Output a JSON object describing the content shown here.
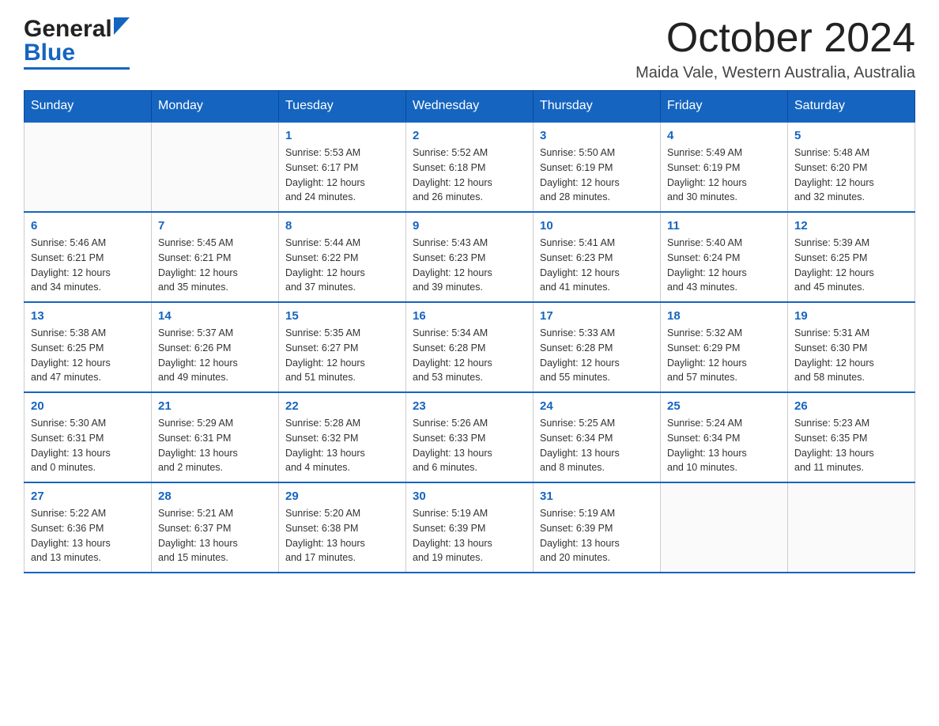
{
  "header": {
    "month_title": "October 2024",
    "location": "Maida Vale, Western Australia, Australia",
    "logo_general": "General",
    "logo_blue": "Blue"
  },
  "calendar": {
    "days_of_week": [
      "Sunday",
      "Monday",
      "Tuesday",
      "Wednesday",
      "Thursday",
      "Friday",
      "Saturday"
    ],
    "weeks": [
      [
        {
          "day": "",
          "details": ""
        },
        {
          "day": "",
          "details": ""
        },
        {
          "day": "1",
          "details": "Sunrise: 5:53 AM\nSunset: 6:17 PM\nDaylight: 12 hours\nand 24 minutes."
        },
        {
          "day": "2",
          "details": "Sunrise: 5:52 AM\nSunset: 6:18 PM\nDaylight: 12 hours\nand 26 minutes."
        },
        {
          "day": "3",
          "details": "Sunrise: 5:50 AM\nSunset: 6:19 PM\nDaylight: 12 hours\nand 28 minutes."
        },
        {
          "day": "4",
          "details": "Sunrise: 5:49 AM\nSunset: 6:19 PM\nDaylight: 12 hours\nand 30 minutes."
        },
        {
          "day": "5",
          "details": "Sunrise: 5:48 AM\nSunset: 6:20 PM\nDaylight: 12 hours\nand 32 minutes."
        }
      ],
      [
        {
          "day": "6",
          "details": "Sunrise: 5:46 AM\nSunset: 6:21 PM\nDaylight: 12 hours\nand 34 minutes."
        },
        {
          "day": "7",
          "details": "Sunrise: 5:45 AM\nSunset: 6:21 PM\nDaylight: 12 hours\nand 35 minutes."
        },
        {
          "day": "8",
          "details": "Sunrise: 5:44 AM\nSunset: 6:22 PM\nDaylight: 12 hours\nand 37 minutes."
        },
        {
          "day": "9",
          "details": "Sunrise: 5:43 AM\nSunset: 6:23 PM\nDaylight: 12 hours\nand 39 minutes."
        },
        {
          "day": "10",
          "details": "Sunrise: 5:41 AM\nSunset: 6:23 PM\nDaylight: 12 hours\nand 41 minutes."
        },
        {
          "day": "11",
          "details": "Sunrise: 5:40 AM\nSunset: 6:24 PM\nDaylight: 12 hours\nand 43 minutes."
        },
        {
          "day": "12",
          "details": "Sunrise: 5:39 AM\nSunset: 6:25 PM\nDaylight: 12 hours\nand 45 minutes."
        }
      ],
      [
        {
          "day": "13",
          "details": "Sunrise: 5:38 AM\nSunset: 6:25 PM\nDaylight: 12 hours\nand 47 minutes."
        },
        {
          "day": "14",
          "details": "Sunrise: 5:37 AM\nSunset: 6:26 PM\nDaylight: 12 hours\nand 49 minutes."
        },
        {
          "day": "15",
          "details": "Sunrise: 5:35 AM\nSunset: 6:27 PM\nDaylight: 12 hours\nand 51 minutes."
        },
        {
          "day": "16",
          "details": "Sunrise: 5:34 AM\nSunset: 6:28 PM\nDaylight: 12 hours\nand 53 minutes."
        },
        {
          "day": "17",
          "details": "Sunrise: 5:33 AM\nSunset: 6:28 PM\nDaylight: 12 hours\nand 55 minutes."
        },
        {
          "day": "18",
          "details": "Sunrise: 5:32 AM\nSunset: 6:29 PM\nDaylight: 12 hours\nand 57 minutes."
        },
        {
          "day": "19",
          "details": "Sunrise: 5:31 AM\nSunset: 6:30 PM\nDaylight: 12 hours\nand 58 minutes."
        }
      ],
      [
        {
          "day": "20",
          "details": "Sunrise: 5:30 AM\nSunset: 6:31 PM\nDaylight: 13 hours\nand 0 minutes."
        },
        {
          "day": "21",
          "details": "Sunrise: 5:29 AM\nSunset: 6:31 PM\nDaylight: 13 hours\nand 2 minutes."
        },
        {
          "day": "22",
          "details": "Sunrise: 5:28 AM\nSunset: 6:32 PM\nDaylight: 13 hours\nand 4 minutes."
        },
        {
          "day": "23",
          "details": "Sunrise: 5:26 AM\nSunset: 6:33 PM\nDaylight: 13 hours\nand 6 minutes."
        },
        {
          "day": "24",
          "details": "Sunrise: 5:25 AM\nSunset: 6:34 PM\nDaylight: 13 hours\nand 8 minutes."
        },
        {
          "day": "25",
          "details": "Sunrise: 5:24 AM\nSunset: 6:34 PM\nDaylight: 13 hours\nand 10 minutes."
        },
        {
          "day": "26",
          "details": "Sunrise: 5:23 AM\nSunset: 6:35 PM\nDaylight: 13 hours\nand 11 minutes."
        }
      ],
      [
        {
          "day": "27",
          "details": "Sunrise: 5:22 AM\nSunset: 6:36 PM\nDaylight: 13 hours\nand 13 minutes."
        },
        {
          "day": "28",
          "details": "Sunrise: 5:21 AM\nSunset: 6:37 PM\nDaylight: 13 hours\nand 15 minutes."
        },
        {
          "day": "29",
          "details": "Sunrise: 5:20 AM\nSunset: 6:38 PM\nDaylight: 13 hours\nand 17 minutes."
        },
        {
          "day": "30",
          "details": "Sunrise: 5:19 AM\nSunset: 6:39 PM\nDaylight: 13 hours\nand 19 minutes."
        },
        {
          "day": "31",
          "details": "Sunrise: 5:19 AM\nSunset: 6:39 PM\nDaylight: 13 hours\nand 20 minutes."
        },
        {
          "day": "",
          "details": ""
        },
        {
          "day": "",
          "details": ""
        }
      ]
    ]
  }
}
